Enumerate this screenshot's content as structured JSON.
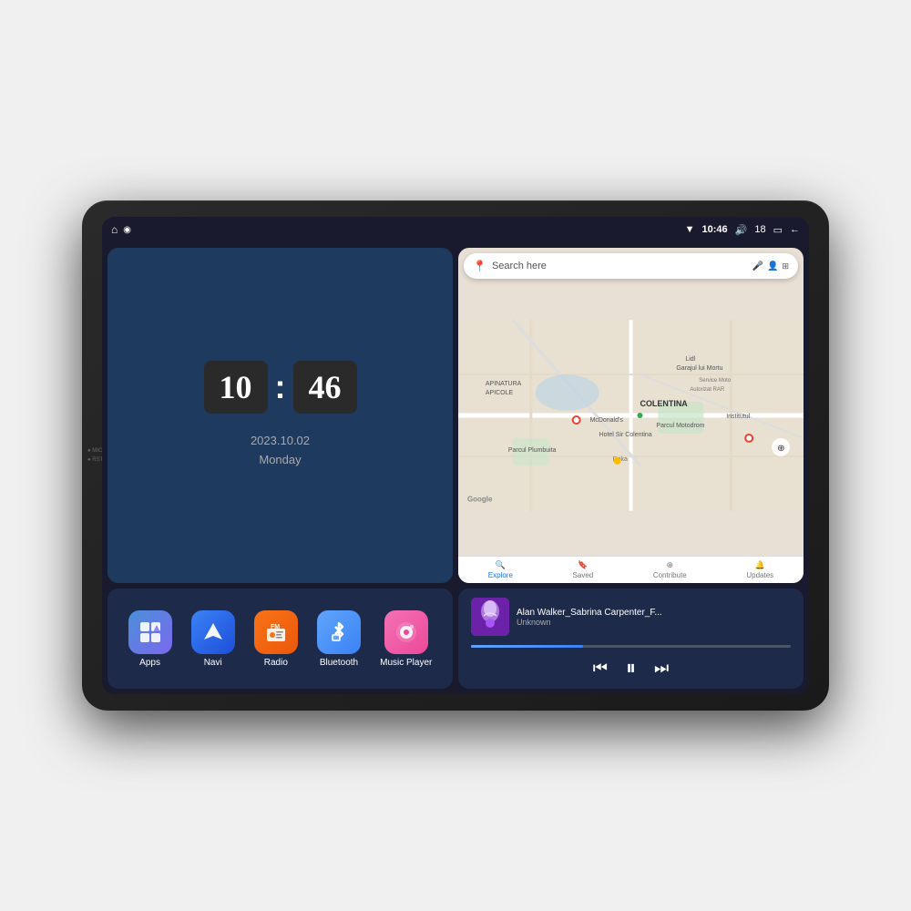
{
  "device": {
    "side_labels": [
      "MIC",
      "RST"
    ]
  },
  "status_bar": {
    "home_icon": "⌂",
    "location_icon": "◉",
    "wifi_icon": "▼",
    "time": "10:46",
    "volume_icon": "🔊",
    "volume_level": "18",
    "battery_icon": "▭",
    "back_icon": "←"
  },
  "clock": {
    "hour": "10",
    "minute": "46",
    "date": "2023.10.02",
    "day": "Monday"
  },
  "map": {
    "search_placeholder": "Search here",
    "tabs": [
      {
        "label": "Explore",
        "active": true
      },
      {
        "label": "Saved",
        "active": false
      },
      {
        "label": "Contribute",
        "active": false
      },
      {
        "label": "Updates",
        "active": false
      }
    ],
    "places": [
      "APINATURA APICOLE",
      "COLENTINA",
      "Garajul lui Mortu",
      "Service Moto",
      "Lidl",
      "McDonald's",
      "Hotel Sir Colentina",
      "Parcul Plumbuita",
      "Roka",
      "Parcul Motodrom",
      "Institutul"
    ]
  },
  "apps": [
    {
      "id": "apps",
      "label": "Apps",
      "icon_type": "apps"
    },
    {
      "id": "navi",
      "label": "Navi",
      "icon_type": "navi"
    },
    {
      "id": "radio",
      "label": "Radio",
      "icon_type": "radio"
    },
    {
      "id": "bluetooth",
      "label": "Bluetooth",
      "icon_type": "bluetooth"
    },
    {
      "id": "music",
      "label": "Music Player",
      "icon_type": "music"
    }
  ],
  "music_player": {
    "title": "Alan Walker_Sabrina Carpenter_F...",
    "artist": "Unknown",
    "progress": "35"
  }
}
